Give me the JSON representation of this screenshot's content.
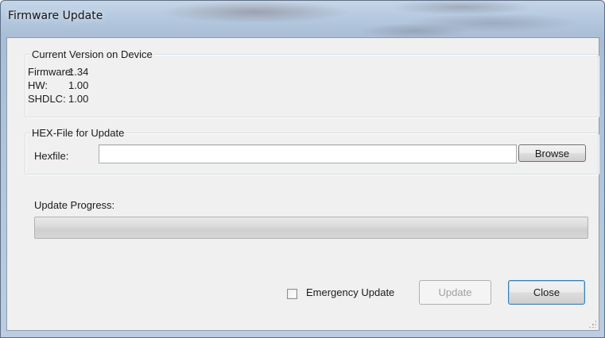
{
  "window": {
    "title": "Firmware Update"
  },
  "current_version": {
    "legend": "Current Version on Device",
    "rows": [
      {
        "label": "Firmware:",
        "value": "1.34"
      },
      {
        "label": "HW:",
        "value": "1.00"
      },
      {
        "label": "SHDLC:",
        "value": "1.00"
      }
    ]
  },
  "hex_file": {
    "legend": "HEX-File for Update",
    "label": "Hexfile:",
    "value": "",
    "browse_label": "Browse"
  },
  "progress": {
    "label": "Update Progress:",
    "value": 0
  },
  "footer": {
    "emergency_label": "Emergency Update",
    "emergency_checked": false,
    "update_label": "Update",
    "close_label": "Close"
  }
}
